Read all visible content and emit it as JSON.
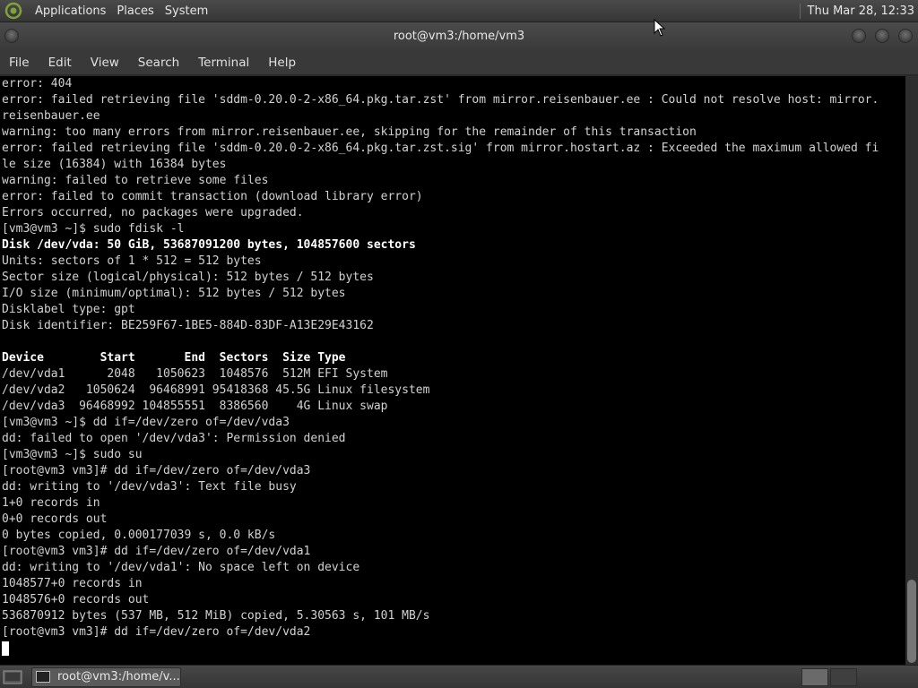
{
  "top_panel": {
    "menus": [
      "Applications",
      "Places",
      "System"
    ],
    "clock": "Thu Mar 28, 12:33"
  },
  "window": {
    "title": "root@vm3:/home/vm3"
  },
  "menubar": {
    "items": [
      "File",
      "Edit",
      "View",
      "Search",
      "Terminal",
      "Help"
    ]
  },
  "terminal": {
    "lines": [
      {
        "text": "error: 404",
        "bold": false
      },
      {
        "text": "error: failed retrieving file 'sddm-0.20.0-2-x86_64.pkg.tar.zst' from mirror.reisenbauer.ee : Could not resolve host: mirror.",
        "bold": false
      },
      {
        "text": "reisenbauer.ee",
        "bold": false
      },
      {
        "text": "warning: too many errors from mirror.reisenbauer.ee, skipping for the remainder of this transaction",
        "bold": false
      },
      {
        "text": "error: failed retrieving file 'sddm-0.20.0-2-x86_64.pkg.tar.zst.sig' from mirror.hostart.az : Exceeded the maximum allowed fi",
        "bold": false
      },
      {
        "text": "le size (16384) with 16384 bytes",
        "bold": false
      },
      {
        "text": "warning: failed to retrieve some files",
        "bold": false
      },
      {
        "text": "error: failed to commit transaction (download library error)",
        "bold": false
      },
      {
        "text": "Errors occurred, no packages were upgraded.",
        "bold": false
      },
      {
        "text": "[vm3@vm3 ~]$ sudo fdisk -l",
        "bold": false
      },
      {
        "text": "Disk /dev/vda: 50 GiB, 53687091200 bytes, 104857600 sectors",
        "bold": true
      },
      {
        "text": "Units: sectors of 1 * 512 = 512 bytes",
        "bold": false
      },
      {
        "text": "Sector size (logical/physical): 512 bytes / 512 bytes",
        "bold": false
      },
      {
        "text": "I/O size (minimum/optimal): 512 bytes / 512 bytes",
        "bold": false
      },
      {
        "text": "Disklabel type: gpt",
        "bold": false
      },
      {
        "text": "Disk identifier: BE259F67-1BE5-884D-83DF-A13E29E43162",
        "bold": false
      },
      {
        "text": "",
        "bold": false
      },
      {
        "text": "Device        Start       End  Sectors  Size Type",
        "bold": true
      },
      {
        "text": "/dev/vda1      2048   1050623  1048576  512M EFI System",
        "bold": false
      },
      {
        "text": "/dev/vda2   1050624  96468991 95418368 45.5G Linux filesystem",
        "bold": false
      },
      {
        "text": "/dev/vda3  96468992 104855551  8386560    4G Linux swap",
        "bold": false
      },
      {
        "text": "[vm3@vm3 ~]$ dd if=/dev/zero of=/dev/vda3",
        "bold": false
      },
      {
        "text": "dd: failed to open '/dev/vda3': Permission denied",
        "bold": false
      },
      {
        "text": "[vm3@vm3 ~]$ sudo su",
        "bold": false
      },
      {
        "text": "[root@vm3 vm3]# dd if=/dev/zero of=/dev/vda3",
        "bold": false
      },
      {
        "text": "dd: writing to '/dev/vda3': Text file busy",
        "bold": false
      },
      {
        "text": "1+0 records in",
        "bold": false
      },
      {
        "text": "0+0 records out",
        "bold": false
      },
      {
        "text": "0 bytes copied, 0.000177039 s, 0.0 kB/s",
        "bold": false
      },
      {
        "text": "[root@vm3 vm3]# dd if=/dev/zero of=/dev/vda1",
        "bold": false
      },
      {
        "text": "dd: writing to '/dev/vda1': No space left on device",
        "bold": false
      },
      {
        "text": "1048577+0 records in",
        "bold": false
      },
      {
        "text": "1048576+0 records out",
        "bold": false
      },
      {
        "text": "536870912 bytes (537 MB, 512 MiB) copied, 5.30563 s, 101 MB/s",
        "bold": false
      },
      {
        "text": "[root@vm3 vm3]# dd if=/dev/zero of=/dev/vda2",
        "bold": false
      }
    ]
  },
  "taskbar": {
    "window_button": "root@vm3:/home/v..."
  },
  "colors": {
    "terminal_bg": "#000000",
    "terminal_fg": "#d2d2d2",
    "panel_bg": "#3c3c3c"
  },
  "icons": {
    "distro_logo": "distro-logo-icon",
    "window_menu": "window-menu-icon",
    "minimize": "minimize-icon",
    "maximize": "maximize-icon",
    "close": "close-icon",
    "show_desktop": "show-desktop-icon",
    "terminal": "terminal-icon"
  }
}
